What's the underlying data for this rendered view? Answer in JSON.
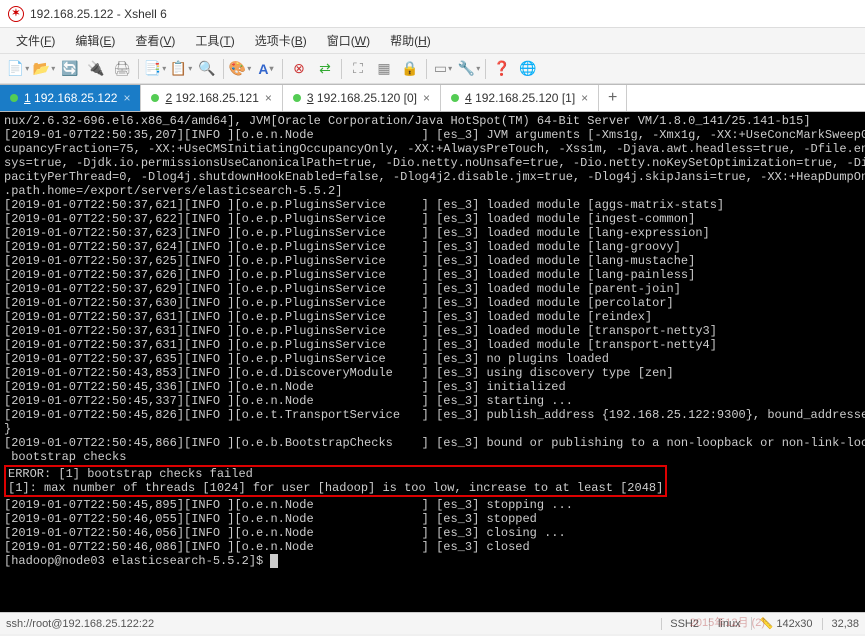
{
  "window": {
    "title": "192.168.25.122 - Xshell 6"
  },
  "menu": {
    "items": [
      {
        "label": "文件",
        "key": "F"
      },
      {
        "label": "编辑",
        "key": "E"
      },
      {
        "label": "查看",
        "key": "V"
      },
      {
        "label": "工具",
        "key": "T"
      },
      {
        "label": "选项卡",
        "key": "B"
      },
      {
        "label": "窗口",
        "key": "W"
      },
      {
        "label": "帮助",
        "key": "H"
      }
    ]
  },
  "tabs": [
    {
      "num": "1",
      "label": "192.168.25.122",
      "active": true
    },
    {
      "num": "2",
      "label": "192.168.25.121",
      "active": false
    },
    {
      "num": "3",
      "label": "192.168.25.120 [0]",
      "active": false
    },
    {
      "num": "4",
      "label": "192.168.25.120 [1]",
      "active": false
    }
  ],
  "terminal": {
    "lines_pre": [
      "nux/2.6.32-696.el6.x86_64/amd64], JVM[Oracle Corporation/Java HotSpot(TM) 64-Bit Server VM/1.8.0_141/25.141-b15]",
      "[2019-01-07T22:50:35,207][INFO ][o.e.n.Node               ] [es_3] JVM arguments [-Xms1g, -Xmx1g, -XX:+UseConcMarkSweepGC,",
      "cupancyFraction=75, -XX:+UseCMSInitiatingOccupancyOnly, -XX:+AlwaysPreTouch, -Xss1m, -Djava.awt.headless=true, -Dfile.enco",
      "sys=true, -Djdk.io.permissionsUseCanonicalPath=true, -Dio.netty.noUnsafe=true, -Dio.netty.noKeySetOptimization=true, -Dio.",
      "pacityPerThread=0, -Dlog4j.shutdownHookEnabled=false, -Dlog4j2.disable.jmx=true, -Dlog4j.skipJansi=true, -XX:+HeapDumpOnOu",
      ".path.home=/export/servers/elasticsearch-5.5.2]",
      "[2019-01-07T22:50:37,621][INFO ][o.e.p.PluginsService     ] [es_3] loaded module [aggs-matrix-stats]",
      "[2019-01-07T22:50:37,622][INFO ][o.e.p.PluginsService     ] [es_3] loaded module [ingest-common]",
      "[2019-01-07T22:50:37,623][INFO ][o.e.p.PluginsService     ] [es_3] loaded module [lang-expression]",
      "[2019-01-07T22:50:37,624][INFO ][o.e.p.PluginsService     ] [es_3] loaded module [lang-groovy]",
      "[2019-01-07T22:50:37,625][INFO ][o.e.p.PluginsService     ] [es_3] loaded module [lang-mustache]",
      "[2019-01-07T22:50:37,626][INFO ][o.e.p.PluginsService     ] [es_3] loaded module [lang-painless]",
      "[2019-01-07T22:50:37,629][INFO ][o.e.p.PluginsService     ] [es_3] loaded module [parent-join]",
      "[2019-01-07T22:50:37,630][INFO ][o.e.p.PluginsService     ] [es_3] loaded module [percolator]",
      "[2019-01-07T22:50:37,631][INFO ][o.e.p.PluginsService     ] [es_3] loaded module [reindex]",
      "[2019-01-07T22:50:37,631][INFO ][o.e.p.PluginsService     ] [es_3] loaded module [transport-netty3]",
      "[2019-01-07T22:50:37,631][INFO ][o.e.p.PluginsService     ] [es_3] loaded module [transport-netty4]",
      "[2019-01-07T22:50:37,635][INFO ][o.e.p.PluginsService     ] [es_3] no plugins loaded",
      "[2019-01-07T22:50:43,853][INFO ][o.e.d.DiscoveryModule    ] [es_3] using discovery type [zen]",
      "[2019-01-07T22:50:45,336][INFO ][o.e.n.Node               ] [es_3] initialized",
      "[2019-01-07T22:50:45,337][INFO ][o.e.n.Node               ] [es_3] starting ...",
      "[2019-01-07T22:50:45,826][INFO ][o.e.t.TransportService   ] [es_3] publish_address {192.168.25.122:9300}, bound_addresses",
      "}",
      "[2019-01-07T22:50:45,866][INFO ][o.e.b.BootstrapChecks    ] [es_3] bound or publishing to a non-loopback or non-link-local",
      " bootstrap checks"
    ],
    "error_lines": [
      "ERROR: [1] bootstrap checks failed",
      "[1]: max number of threads [1024] for user [hadoop] is too low, increase to at least [2048]"
    ],
    "lines_post": [
      "[2019-01-07T22:50:45,895][INFO ][o.e.n.Node               ] [es_3] stopping ...",
      "[2019-01-07T22:50:46,055][INFO ][o.e.n.Node               ] [es_3] stopped",
      "[2019-01-07T22:50:46,056][INFO ][o.e.n.Node               ] [es_3] closing ...",
      "[2019-01-07T22:50:46,086][INFO ][o.e.n.Node               ] [es_3] closed"
    ],
    "prompt": "[hadoop@node03 elasticsearch-5.5.2]$ "
  },
  "status": {
    "left": "ssh://root@192.168.25.122:22",
    "ssh": "SSH2",
    "os": "linux",
    "size": "142x30",
    "pos": "32,38"
  },
  "watermark": "142x30   32,38",
  "watermark2": "2015年12月 (2)"
}
